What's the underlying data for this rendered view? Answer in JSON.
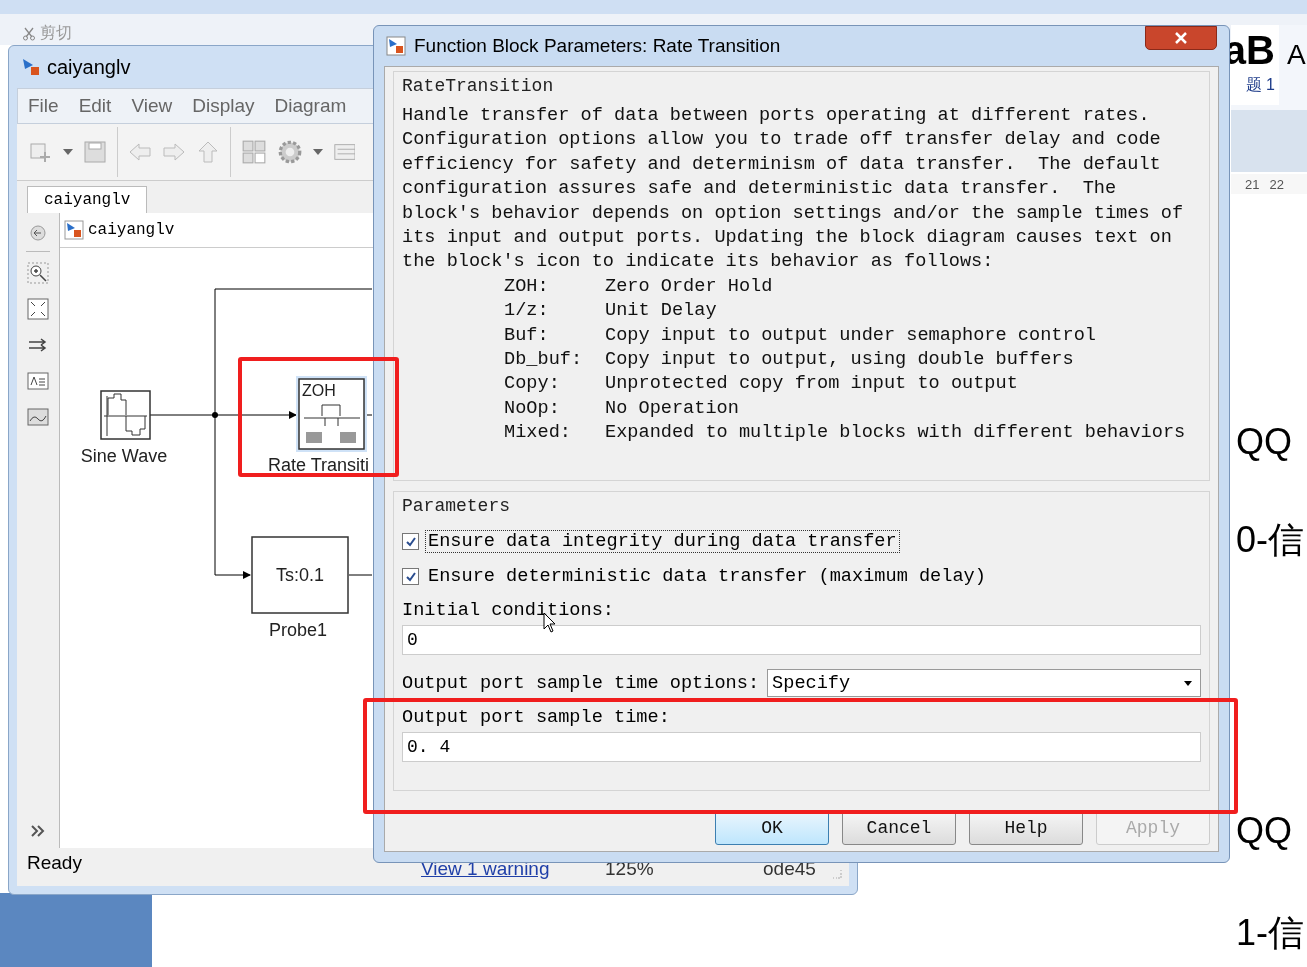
{
  "background_app": {
    "clipboard_label": "剪切",
    "style_preview": "aB",
    "style_name": "题 1",
    "style_preview_cut": "A",
    "ruler": [
      "21",
      "22"
    ],
    "document_lines": [
      "QQ",
      "0-信",
      "QQ",
      "1-信"
    ]
  },
  "model_window": {
    "title": "caiyanglv",
    "menu": [
      "File",
      "Edit",
      "View",
      "Display",
      "Diagram"
    ],
    "tab": {
      "label": "caiyanglv",
      "selected": true
    },
    "breadcrumb": "caiyanglv",
    "blocks": [
      {
        "kind": "sine",
        "label": "Sine Wave"
      },
      {
        "kind": "rate_transition",
        "label": "Rate Transiti",
        "icon_text": "ZOH"
      },
      {
        "kind": "probe",
        "label": "Probe1",
        "icon_text": "Ts:0.1"
      }
    ],
    "status_bar": {
      "state": "Ready",
      "warning_link": "View 1 warning",
      "zoom": "125%",
      "solver": "ode45"
    }
  },
  "dialog": {
    "title": "Function Block Parameters: Rate Transition",
    "block_group": "RateTransition",
    "description": "Handle transfer of data between ports operating at different rates.\nConfiguration options allow you to trade off transfer delay and code\nefficiency for safety and determinism of data transfer.  The default\nconfiguration assures safe and deterministic data transfer.  The\nblock's behavior depends on option settings and/or the sample times of\nits input and output ports. Updating the block diagram causes text on\nthe block's icon to indicate its behavior as follows:",
    "legend": [
      {
        "code": "ZOH:",
        "meaning": "Zero Order Hold"
      },
      {
        "code": "1/z:",
        "meaning": "Unit Delay"
      },
      {
        "code": "Buf:",
        "meaning": "Copy input to output under semaphore control"
      },
      {
        "code": "Db_buf:",
        "meaning": "Copy input to output, using double buffers"
      },
      {
        "code": "Copy:",
        "meaning": "Unprotected copy from input to output"
      },
      {
        "code": "NoOp:",
        "meaning": "No Operation"
      },
      {
        "code": "Mixed:",
        "meaning": "Expanded to multiple blocks with different behaviors"
      }
    ],
    "parameters_group": "Parameters",
    "checkboxes": [
      {
        "label": "Ensure data integrity during data transfer",
        "checked": true,
        "focused": true
      },
      {
        "label": "Ensure deterministic data transfer (maximum delay)",
        "checked": true,
        "focused": false
      }
    ],
    "initial_conditions": {
      "label": "Initial conditions:",
      "value": "0"
    },
    "sample_time_options": {
      "label": "Output port sample time options:",
      "value": "Specify"
    },
    "sample_time": {
      "label": "Output port sample time:",
      "value": "0. 4"
    },
    "buttons": [
      {
        "label": "OK",
        "default": true,
        "disabled": false
      },
      {
        "label": "Cancel",
        "default": false,
        "disabled": false
      },
      {
        "label": "Help",
        "default": false,
        "disabled": false
      },
      {
        "label": "Apply",
        "default": false,
        "disabled": true
      }
    ]
  }
}
